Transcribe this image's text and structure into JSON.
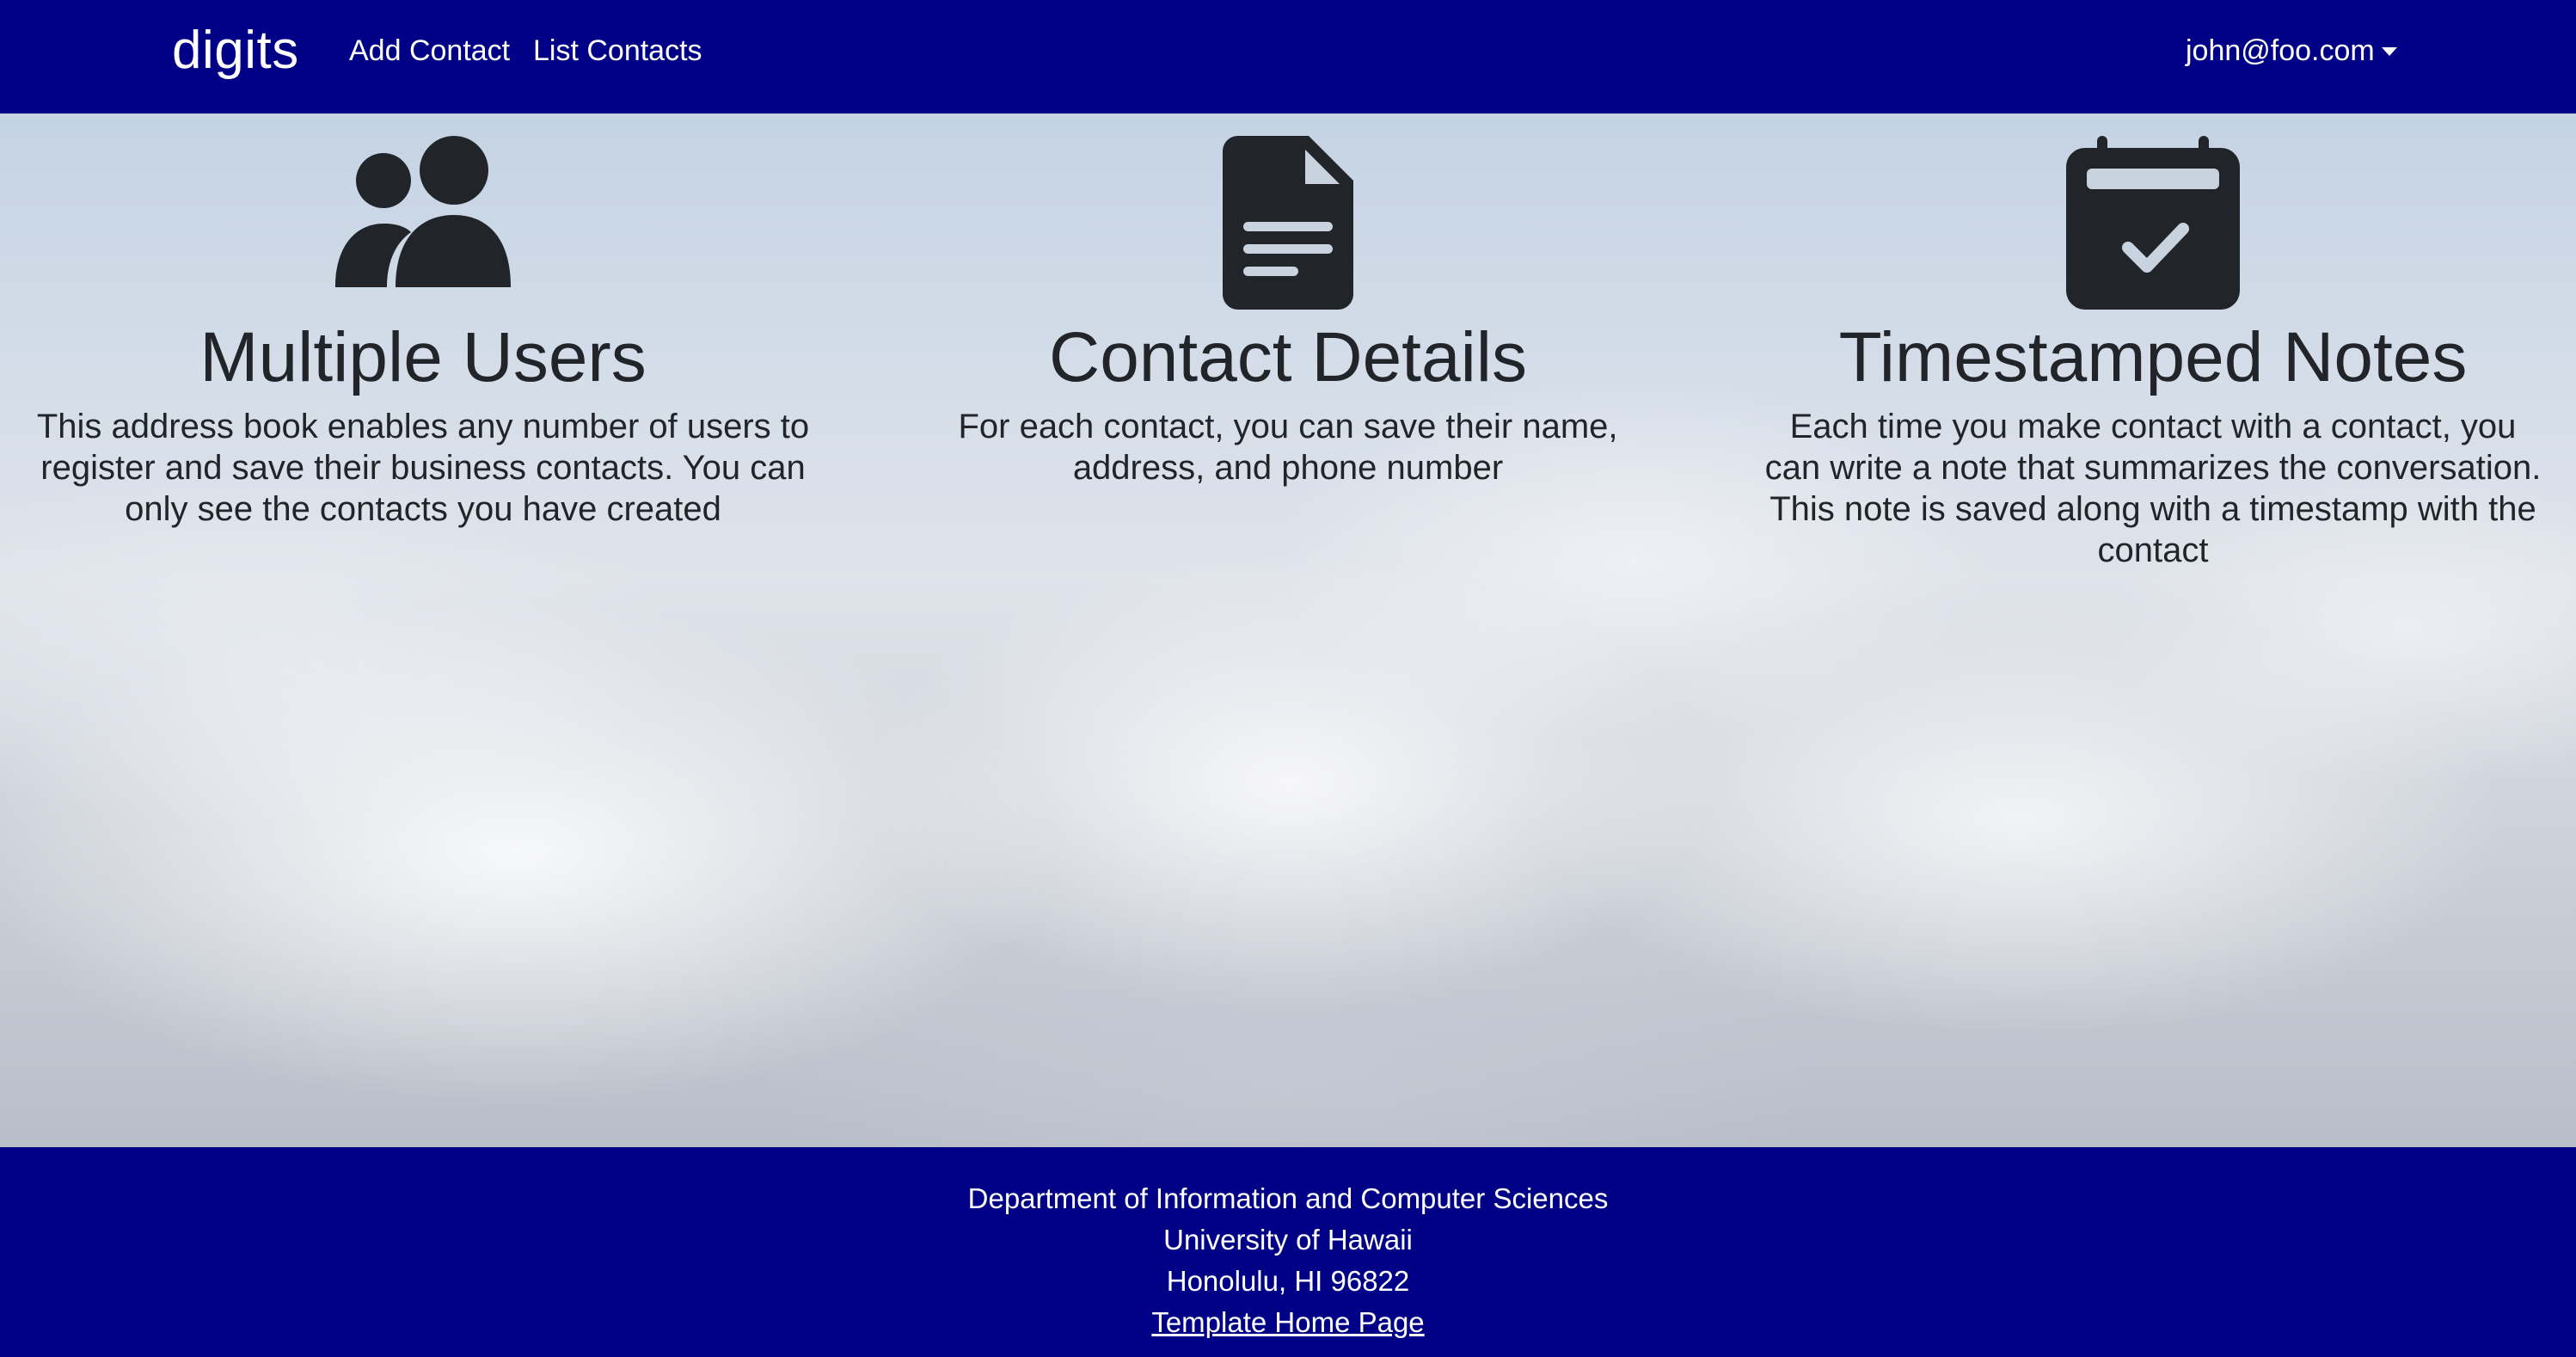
{
  "navbar": {
    "brand": "digits",
    "links": [
      {
        "label": "Add Contact"
      },
      {
        "label": "List Contacts"
      }
    ],
    "user": "john@foo.com",
    "background": "#000087"
  },
  "features": [
    {
      "icon": "users-icon",
      "title": "Multiple Users",
      "text": "This address book enables any number of users to register and save their business contacts. You can only see the contacts you have created"
    },
    {
      "icon": "file-text-icon",
      "title": "Contact Details",
      "text": "For each contact, you can save their name, address, and phone number"
    },
    {
      "icon": "calendar-check-icon",
      "title": "Timestamped Notes",
      "text": "Each time you make contact with a contact, you can write a note that summarizes the conversation. This note is saved along with a timestamp with the contact"
    }
  ],
  "footer": {
    "line1": "Department of Information and Computer Sciences",
    "line2": "University of Hawaii",
    "line3": "Honolulu, HI 96822",
    "link": "Template Home Page"
  }
}
